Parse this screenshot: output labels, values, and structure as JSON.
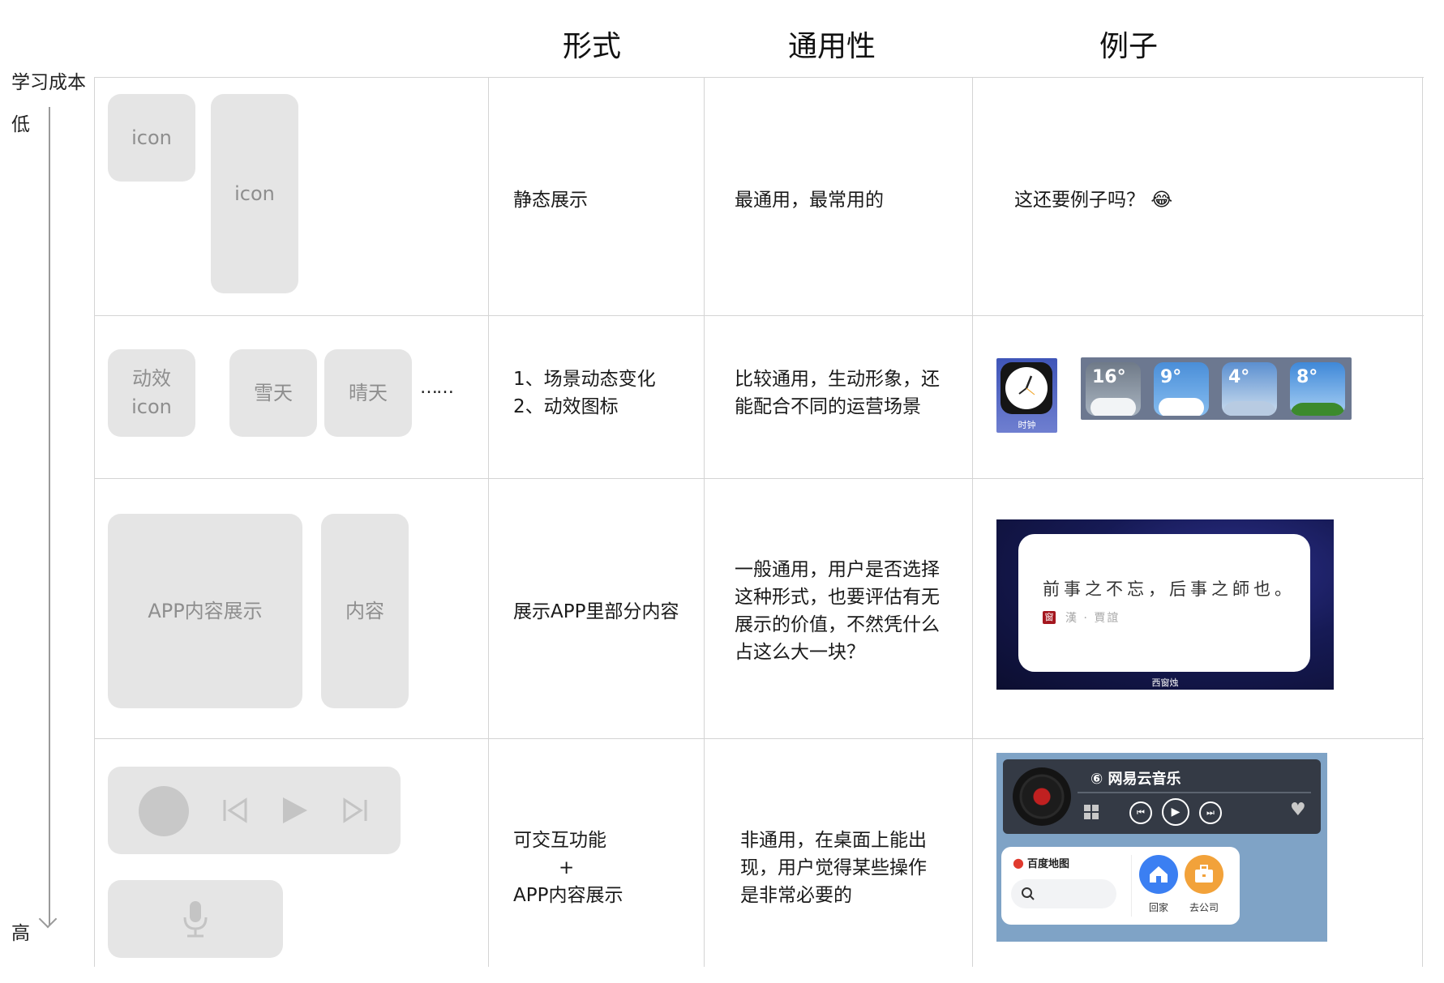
{
  "headers": {
    "form": "形式",
    "generality": "通用性",
    "example": "例子"
  },
  "axis": {
    "title": "学习成本",
    "low": "低",
    "high": "高"
  },
  "rows": [
    {
      "tiles": [
        "icon",
        "icon"
      ],
      "form": [
        "静态展示"
      ],
      "generality": [
        "最通用，最常用的"
      ],
      "example": "这还要例子吗？ 😂"
    },
    {
      "tiles": [
        "动效 icon",
        "雪天",
        "晴天"
      ],
      "ellipsis": "……",
      "form": [
        "1、场景动态变化",
        "2、动效图标"
      ],
      "generality": [
        "比较通用，生动形象，还",
        "能配合不同的运营场景"
      ],
      "example": {
        "clock_label": "时钟",
        "temps": [
          "16°",
          "9°",
          "4°",
          "8°"
        ]
      }
    },
    {
      "tiles": [
        "APP内容展示",
        "内容"
      ],
      "form": [
        "展示APP里部分内容"
      ],
      "generality": [
        "一般通用，用户是否选择",
        "这种形式，也要评估有无",
        "展示的价值，不然凭什么",
        "占这么大一块？"
      ],
      "example": {
        "poem": "前事之不忘，后事之師也。",
        "seal": "窗",
        "author": "漢 · 賈誼",
        "app": "西窗烛"
      }
    },
    {
      "form": [
        "可交互功能",
        "+",
        "APP内容展示"
      ],
      "generality": [
        "非通用，在桌面上能出",
        "现，用户觉得某些操作",
        "是非常必要的"
      ],
      "example": {
        "music_app": "网易云音乐",
        "map_app": "百度地图",
        "home": "回家",
        "company": "去公司"
      }
    }
  ]
}
